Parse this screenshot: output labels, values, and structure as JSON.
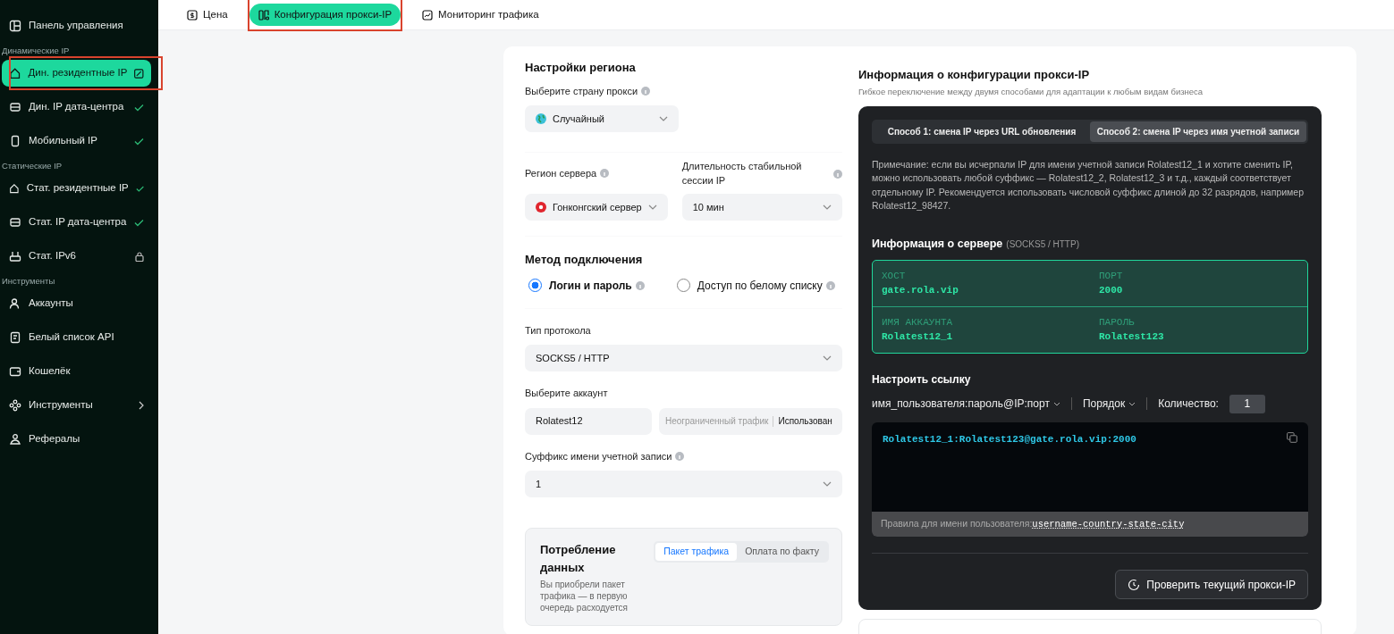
{
  "sidebar": {
    "items": [
      {
        "kind": "item",
        "label": "Панель управления",
        "selected": false,
        "activated": false,
        "locked": false,
        "badge": false,
        "expandable": false,
        "annotated": false
      },
      {
        "kind": "section",
        "label": "Динамические IP"
      },
      {
        "kind": "item",
        "label": "Дин. резидентные IP",
        "selected": true,
        "activated": false,
        "locked": false,
        "badge": true,
        "expandable": false,
        "annotated": true
      },
      {
        "kind": "item",
        "label": "Дин. IP дата-центра",
        "selected": false,
        "activated": true,
        "locked": false,
        "badge": false,
        "expandable": false,
        "annotated": false
      },
      {
        "kind": "item",
        "label": "Мобильный IP",
        "selected": false,
        "activated": true,
        "locked": false,
        "badge": false,
        "expandable": false,
        "annotated": false
      },
      {
        "kind": "section",
        "label": "Статические IP"
      },
      {
        "kind": "item",
        "label": "Стат. резидентные IP",
        "selected": false,
        "activated": true,
        "locked": false,
        "badge": false,
        "expandable": false,
        "annotated": false
      },
      {
        "kind": "item",
        "label": "Стат. IP дата-центра",
        "selected": false,
        "activated": true,
        "locked": false,
        "badge": false,
        "expandable": false,
        "annotated": false
      },
      {
        "kind": "item",
        "label": "Стат. IPv6",
        "selected": false,
        "activated": false,
        "locked": true,
        "badge": false,
        "expandable": false,
        "annotated": false
      },
      {
        "kind": "section",
        "label": "Инструменты"
      },
      {
        "kind": "item",
        "label": "Аккаунты",
        "selected": false,
        "activated": false,
        "locked": false,
        "badge": false,
        "expandable": false,
        "annotated": false
      },
      {
        "kind": "item",
        "label": "Белый список API",
        "selected": false,
        "activated": false,
        "locked": false,
        "badge": false,
        "expandable": false,
        "annotated": false
      },
      {
        "kind": "item",
        "label": "Кошелёк",
        "selected": false,
        "activated": false,
        "locked": false,
        "badge": false,
        "expandable": false,
        "annotated": false
      },
      {
        "kind": "item",
        "label": "Инструменты",
        "selected": false,
        "activated": false,
        "locked": false,
        "badge": false,
        "expandable": true,
        "annotated": false
      },
      {
        "kind": "item",
        "label": "Рефералы",
        "selected": false,
        "activated": false,
        "locked": false,
        "badge": false,
        "expandable": false,
        "annotated": false
      }
    ]
  },
  "tabs": [
    {
      "label": "Цена",
      "selected": false,
      "annotated": false
    },
    {
      "label": "Конфигурация прокси-IP",
      "selected": true,
      "annotated": true
    },
    {
      "label": "Мониторинг трафика",
      "selected": false,
      "annotated": false
    }
  ],
  "settings": {
    "region_title": "Настройки региона",
    "country_label": "Выберите страну прокси",
    "country_value": "Случайный",
    "server_label": "Регион сервера",
    "server_value": "Гонконгский сервер",
    "session_label": "Длительность стабильной сессии IP",
    "session_value": "10 мин",
    "method_title": "Метод подключения",
    "methods": [
      {
        "label": "Логин и пароль",
        "selected": true
      },
      {
        "label": "Доступ по белому списку",
        "selected": false
      }
    ],
    "protocol_label": "Тип протокола",
    "protocol_value": "SOCKS5 / HTTP",
    "account_label": "Выберите аккаунт",
    "account_value": "Rolatest12",
    "account_traffic": "Неограниченный трафик",
    "account_used": "Использован",
    "suffix_label": "Суффикс имени учетной записи",
    "suffix_value": "1",
    "consumption": {
      "title": "Потребление данных",
      "options": [
        {
          "label": "Пакет трафика",
          "selected": true
        },
        {
          "label": "Оплата по факту",
          "selected": false
        }
      ],
      "description": "Вы приобрели пакет трафика — в первую очередь расходуется"
    }
  },
  "info": {
    "title": "Информация о конфигурации прокси-IP",
    "subtitle": "Гибкое переключение между двумя способами для адаптации к любым видам бизнеса",
    "methods": [
      {
        "label": "Способ 1: смена IP через URL обновления",
        "selected": false
      },
      {
        "label": "Способ 2: смена IP через имя учетной записи",
        "selected": true
      }
    ],
    "note": "Примечание: если вы исчерпали IP для имени учетной записи Rolatest12_1 и хотите сменить IP, можно использовать любой суффикс — Rolatest12_2, Rolatest12_3 и т.д., каждый соответствует отдельному IP. Рекомендуется использовать числовой суффикс длиной до 32 разрядов, например Rolatest12_98427.",
    "server_title": "Информация о сервере",
    "server_protocol": "(SOCKS5 / HTTP)",
    "server_fields": [
      {
        "label": "ХОСТ",
        "value": "gate.rola.vip"
      },
      {
        "label": "ПОРТ",
        "value": "2000"
      },
      {
        "label": "ИМЯ АККАУНТА",
        "value": "Rolatest12_1"
      },
      {
        "label": "ПАРОЛЬ",
        "value": "Rolatest123"
      }
    ],
    "link_title": "Настроить ссылку",
    "format": "имя_пользователя:пароль@IP:порт",
    "order": "Порядок",
    "quantity_label": "Количество:",
    "quantity": "1",
    "link": "Rolatest12_1:Rolatest123@gate.rola.vip:2000",
    "rules_label": "Правила для имени пользователя:",
    "rules_value": "username-country-state-city",
    "check_button": "Проверить текущий прокси-IP"
  }
}
